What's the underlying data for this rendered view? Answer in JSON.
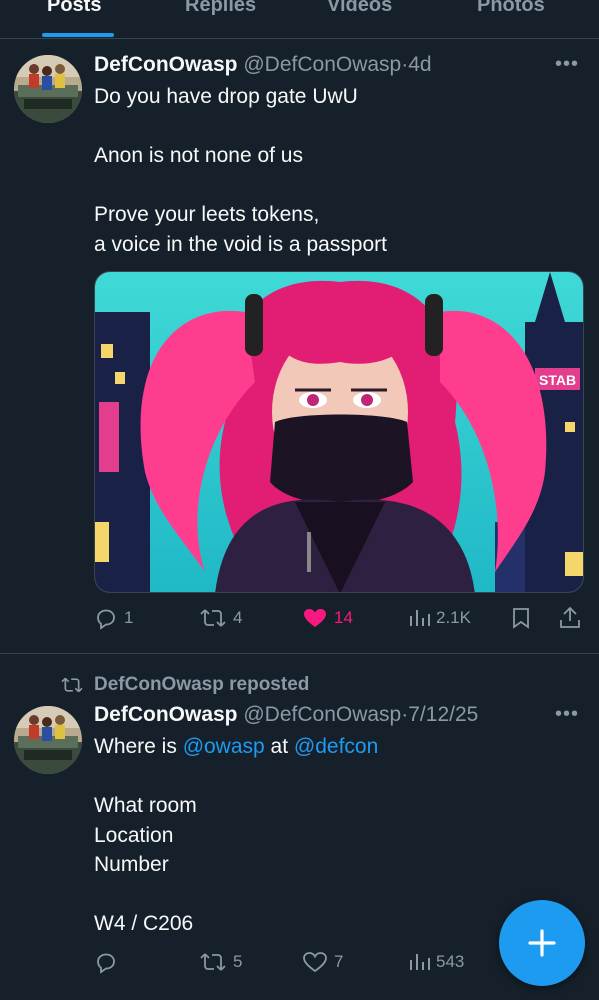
{
  "tabs": [
    {
      "label": "Posts"
    },
    {
      "label": "Replies"
    },
    {
      "label": "Videos"
    },
    {
      "label": "Photos"
    }
  ],
  "posts": [
    {
      "author": "DefConOwasp",
      "handle": "@DefConOwasp",
      "separator": "·",
      "time": "4d",
      "lines": [
        "Do you have drop gate UwU",
        "Anon is not none of us",
        "Prove your leets tokens,",
        "a voice in the void is a passport"
      ],
      "media_sign_text": "STAB",
      "stats": {
        "replies": "1",
        "reposts": "4",
        "likes": "14",
        "views": "2.1K"
      }
    },
    {
      "repost_label": "DefConOwasp reposted",
      "author": "DefConOwasp",
      "handle": "@DefConOwasp",
      "separator": "·",
      "time": "7/12/25",
      "line1_prefix": "Where is ",
      "mention1": "@owasp",
      "line1_mid": " at ",
      "mention2": "@defcon",
      "lines": [
        "What room",
        "Location",
        "Number",
        "W4 / C206"
      ],
      "stats": {
        "replies": "",
        "reposts": "5",
        "likes": "7",
        "views": "543"
      }
    }
  ],
  "colors": {
    "background": "#15202b",
    "accent": "#1d9bf0",
    "like": "#f91880",
    "secondary_text": "#8b98a5",
    "divider": "#38444d"
  },
  "icons": [
    "reply-icon",
    "repost-icon",
    "heart-icon",
    "views-icon",
    "bookmark-icon",
    "share-icon",
    "more-icon",
    "plus-icon"
  ]
}
